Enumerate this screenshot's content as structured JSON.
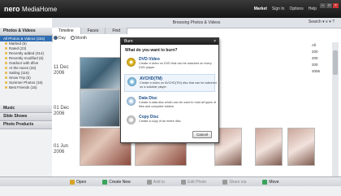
{
  "app": {
    "brand": "nero",
    "product": "MediaHome",
    "nav": [
      "Market",
      "Sign In",
      "Options",
      "Help"
    ],
    "window_buttons": [
      "–",
      "□",
      "×"
    ]
  },
  "header": {
    "title": "Browsing Photos & Videos",
    "tools": "Search ▾  ≡ ▾ ?"
  },
  "sidebar": {
    "photos_section": "Photos & Videos",
    "selected": "All Photos & Videos (334)",
    "items": [
      "Marked (5)",
      "Rated (23)",
      "Recently added (314)",
      "Recently modified (6)",
      "Outdoor with dfive",
      "At the races (33)",
      "Sailing (116)",
      "Snow Trip (5)",
      "Summer Photos (16)",
      "Best Friends (15)"
    ],
    "music_section": "Music",
    "slideshows_section": "Slide Shows",
    "products_section": "Photo Products"
  },
  "tabs": [
    "Timeline",
    "Faces",
    "Find"
  ],
  "view_options": [
    "Day",
    "Month"
  ],
  "content": {
    "dates": [
      "11 Dec 2006",
      "01 Dec 2006",
      "01 Jun 2006"
    ]
  },
  "right_labels": [
    "All",
    "200",
    "200",
    "200",
    "2006"
  ],
  "bottom_toolbar": {
    "buttons": [
      "Open",
      "Create New",
      "Add to",
      "Edit Photo",
      "Share via",
      "Move"
    ]
  },
  "dialog": {
    "title": "Burn",
    "close": "×",
    "question": "What do you want to burn?",
    "options": [
      {
        "title": "DVD-Video",
        "desc": "Create a video on DVD that can be watched on every DVD player"
      },
      {
        "title": "AVCHD(TM)",
        "desc": "Create a video on AVCHD(TM) disc that can be watched on a suitable player"
      },
      {
        "title": "Data Disc",
        "desc": "Create a data disc which can be used to hold all types of files and complete folders"
      },
      {
        "title": "Copy Disc",
        "desc": "Create a copy of an entire disc."
      }
    ],
    "cancel": "Cancel"
  }
}
